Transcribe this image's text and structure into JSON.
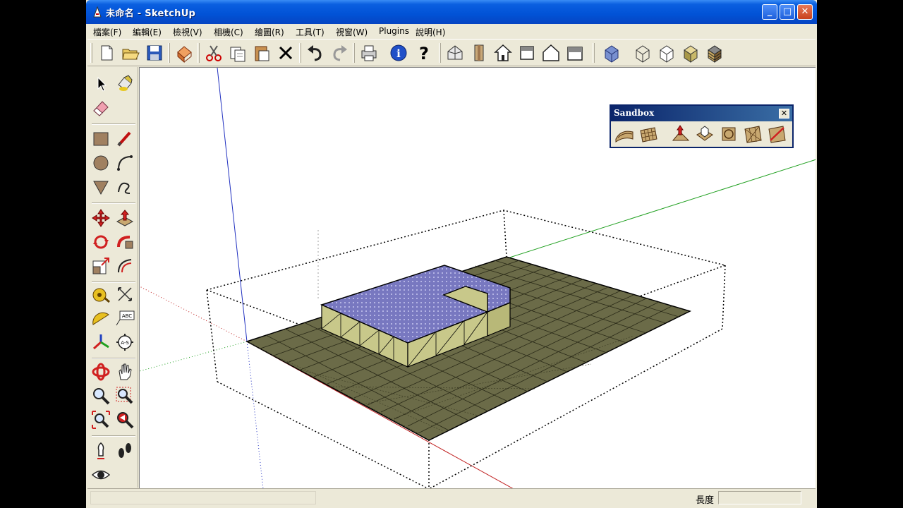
{
  "window": {
    "title": "未命名 - SketchUp",
    "controls": {
      "minimize": "_",
      "maximize": "□",
      "close": "✕"
    }
  },
  "menu": {
    "items": [
      {
        "label": "檔案(F)",
        "id": "file"
      },
      {
        "label": "編輯(E)",
        "id": "edit"
      },
      {
        "label": "檢視(V)",
        "id": "view"
      },
      {
        "label": "相機(C)",
        "id": "camera"
      },
      {
        "label": "繪圖(R)",
        "id": "draw"
      },
      {
        "label": "工具(T)",
        "id": "tools"
      },
      {
        "label": "視窗(W)",
        "id": "window"
      },
      {
        "label": "Plugins",
        "id": "plugins"
      },
      {
        "label": "說明(H)",
        "id": "help"
      }
    ]
  },
  "toolbar": {
    "icons": [
      "new-icon",
      "open-icon",
      "save-icon",
      "make-component-icon",
      "cut-icon",
      "copy-icon",
      "paste-icon",
      "erase-icon",
      "undo-icon",
      "redo-icon",
      "print-icon",
      "model-info-icon",
      "help-icon",
      "iso-view-icon",
      "top-view-icon",
      "front-view-icon",
      "right-view-icon",
      "back-view-icon",
      "left-view-icon",
      "xray-icon",
      "wireframe-icon",
      "hidden-line-icon",
      "shaded-icon",
      "shaded-texture-icon"
    ]
  },
  "left_toolbar": {
    "icons": [
      "select-icon",
      "paint-bucket-icon",
      "eraser-icon",
      "rectangle-icon",
      "line-icon",
      "circle-icon",
      "arc-icon",
      "polygon-icon",
      "freehand-icon",
      "move-icon",
      "push-pull-icon",
      "rotate-icon",
      "follow-me-icon",
      "scale-icon",
      "offset-icon",
      "tape-measure-icon",
      "dimension-icon",
      "protractor-icon",
      "text-icon",
      "axes-icon",
      "3d-text-icon",
      "orbit-icon",
      "pan-icon",
      "zoom-icon",
      "zoom-window-icon",
      "zoom-extents-icon",
      "previous-view-icon",
      "position-camera-icon",
      "walk-icon",
      "look-around-icon"
    ]
  },
  "sandbox": {
    "title": "Sandbox",
    "close": "✕",
    "icons": [
      "from-contours-icon",
      "from-scratch-icon",
      "smoove-icon",
      "stamp-icon",
      "drape-icon",
      "add-detail-icon",
      "flip-edge-icon"
    ]
  },
  "status": {
    "label": "長度",
    "value": ""
  },
  "colors": {
    "terrain": "#6b6b48",
    "building_wall": "#c8c88a",
    "roof": "#8c8cd0",
    "titlebar": "#0152d6"
  }
}
